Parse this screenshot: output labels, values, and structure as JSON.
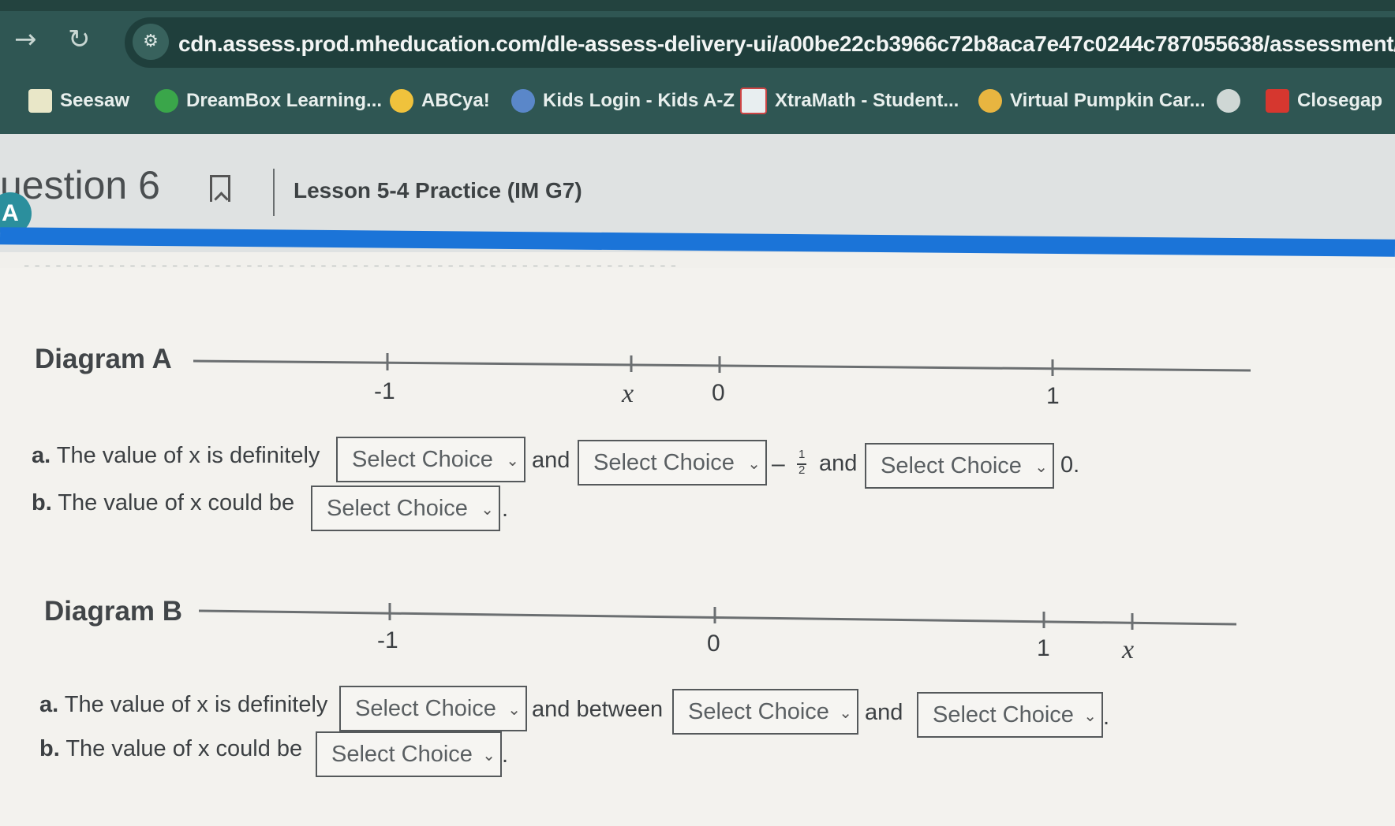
{
  "browser": {
    "url": "cdn.assess.prod.mheducation.com/dle-assess-delivery-ui/a00be22cb3966c72b8aca7e47c0244c787055638/assessment/pag",
    "bookmarks": [
      {
        "label": "Seesaw",
        "icon": "seesaw-icon",
        "color": "#e9e7c8"
      },
      {
        "label": "DreamBox Learning...",
        "icon": "dreambox-icon",
        "color": "#3aa64a"
      },
      {
        "label": "ABCya!",
        "icon": "abcya-icon",
        "color": "#f0c23c"
      },
      {
        "label": "Kids Login - Kids A-Z",
        "icon": "kids-az-icon",
        "color": "#5a87c9"
      },
      {
        "label": "XtraMath - Student...",
        "icon": "xtramath-icon",
        "color": "#e8eef0"
      },
      {
        "label": "Virtual Pumpkin Car...",
        "icon": "pumpkin-icon",
        "color": "#e8b540"
      },
      {
        "label": "",
        "icon": "globe-icon",
        "color": "#cfd7d5"
      },
      {
        "label": "Closegap",
        "icon": "closegap-icon",
        "color": "#d6372f"
      }
    ]
  },
  "header": {
    "question": "uestion 6",
    "lesson": "Lesson 5-4 Practice (IM G7)",
    "avatar": "A"
  },
  "diagramA": {
    "label": "Diagram A",
    "ticks": [
      "-1",
      "x",
      "0",
      "1"
    ],
    "a": {
      "prefix": "a.",
      "text1": "The value of x is definitely",
      "text2": "and",
      "frac_sign": "–",
      "frac_num": "1",
      "frac_den": "2",
      "text3": "and",
      "text4": "0."
    },
    "b": {
      "prefix": "b.",
      "text1": "The value of x could be",
      "end": "."
    },
    "select_label": "Select Choice"
  },
  "diagramB": {
    "label": "Diagram B",
    "ticks": [
      "-1",
      "0",
      "1",
      "x"
    ],
    "a": {
      "prefix": "a.",
      "text1": "The value of x is definitely",
      "text2": "and between",
      "text3": "and",
      "end": "."
    },
    "b": {
      "prefix": "b.",
      "text1": "The value of x could be",
      "end": "."
    },
    "select_label": "Select Choice"
  }
}
